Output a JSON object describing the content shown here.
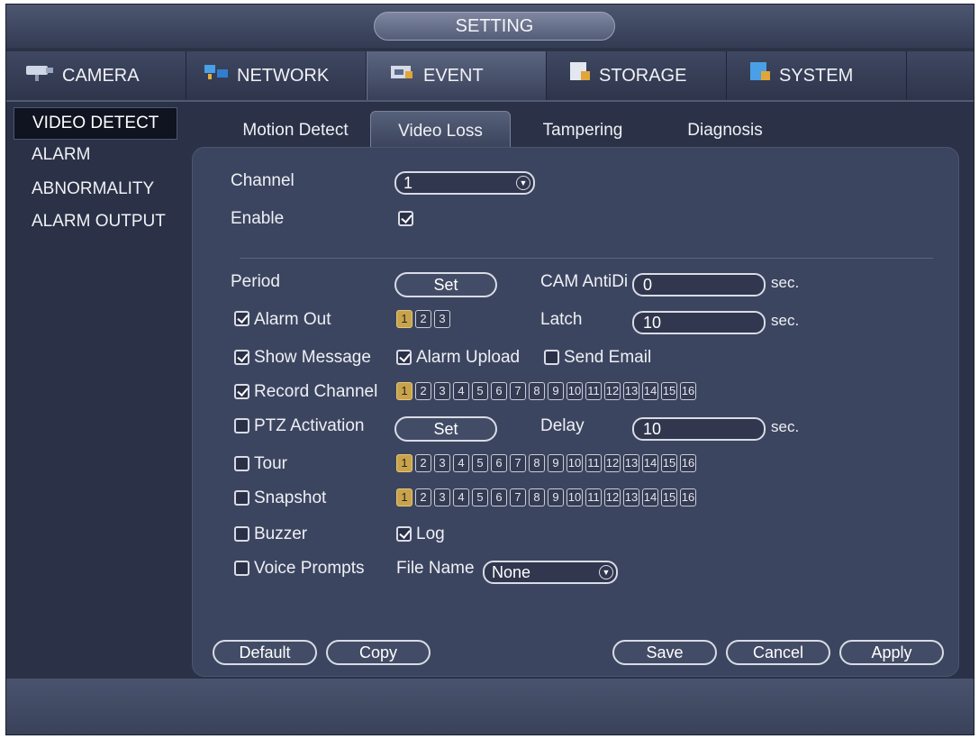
{
  "window": {
    "title": "SETTING"
  },
  "main_tabs": [
    {
      "label": "CAMERA",
      "icon": "camera-icon"
    },
    {
      "label": "NETWORK",
      "icon": "network-icon"
    },
    {
      "label": "EVENT",
      "icon": "event-icon"
    },
    {
      "label": "STORAGE",
      "icon": "storage-icon"
    },
    {
      "label": "SYSTEM",
      "icon": "system-icon"
    }
  ],
  "active_main_tab": "EVENT",
  "sidebar": {
    "items": [
      {
        "label": "VIDEO DETECT"
      },
      {
        "label": "ALARM"
      },
      {
        "label": "ABNORMALITY"
      },
      {
        "label": "ALARM OUTPUT"
      }
    ],
    "active": "VIDEO DETECT"
  },
  "sub_tabs": [
    {
      "label": "Motion Detect"
    },
    {
      "label": "Video Loss"
    },
    {
      "label": "Tampering"
    },
    {
      "label": "Diagnosis"
    }
  ],
  "active_sub_tab": "Video Loss",
  "form": {
    "channel": {
      "label": "Channel",
      "value": "1"
    },
    "enable": {
      "label": "Enable",
      "checked": true
    },
    "period": {
      "label": "Period",
      "button": "Set"
    },
    "cam_antidither": {
      "label": "CAM AntiDi",
      "value": "0",
      "unit": "sec."
    },
    "alarm_out": {
      "label": "Alarm Out",
      "checked": true,
      "outputs": [
        "1",
        "2",
        "3"
      ],
      "selected": [
        "1"
      ]
    },
    "latch": {
      "label": "Latch",
      "value": "10",
      "unit": "sec."
    },
    "show_message": {
      "label": "Show Message",
      "checked": true
    },
    "alarm_upload": {
      "label": "Alarm Upload",
      "checked": true
    },
    "send_email": {
      "label": "Send Email",
      "checked": false
    },
    "record_channel": {
      "label": "Record Channel",
      "checked": true,
      "selected": [
        "1"
      ]
    },
    "ptz_activation": {
      "label": "PTZ Activation",
      "checked": false,
      "button": "Set"
    },
    "delay": {
      "label": "Delay",
      "value": "10",
      "unit": "sec."
    },
    "tour": {
      "label": "Tour",
      "checked": false,
      "selected": [
        "1"
      ]
    },
    "snapshot": {
      "label": "Snapshot",
      "checked": false,
      "selected": [
        "1"
      ]
    },
    "buzzer": {
      "label": "Buzzer",
      "checked": false
    },
    "log": {
      "label": "Log",
      "checked": true
    },
    "voice_prompts": {
      "label": "Voice Prompts",
      "checked": false
    },
    "file_name": {
      "label": "File Name",
      "value": "None"
    }
  },
  "channels": [
    "1",
    "2",
    "3",
    "4",
    "5",
    "6",
    "7",
    "8",
    "9",
    "10",
    "11",
    "12",
    "13",
    "14",
    "15",
    "16"
  ],
  "buttons": {
    "default": "Default",
    "copy": "Copy",
    "save": "Save",
    "cancel": "Cancel",
    "apply": "Apply"
  },
  "colors": {
    "background": "#2b3247",
    "panel": "#3c4560",
    "selected_channel": "#c9a34a"
  }
}
